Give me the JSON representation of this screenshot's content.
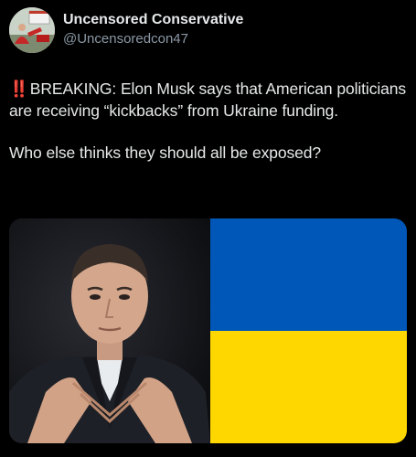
{
  "author": {
    "display_name": "Uncensored Conservative",
    "handle": "@Uncensoredcon47"
  },
  "post": {
    "alert_icon": "double-exclamation-icon",
    "alert_glyph": "‼️",
    "paragraph1": "BREAKING: Elon Musk says that American politicians are receiving “kickbacks” from Ukraine funding.",
    "paragraph2": "Who else thinks they should all be exposed?"
  },
  "media": {
    "flag_colors": {
      "blue": "#0057b7",
      "yellow": "#ffd700"
    }
  }
}
